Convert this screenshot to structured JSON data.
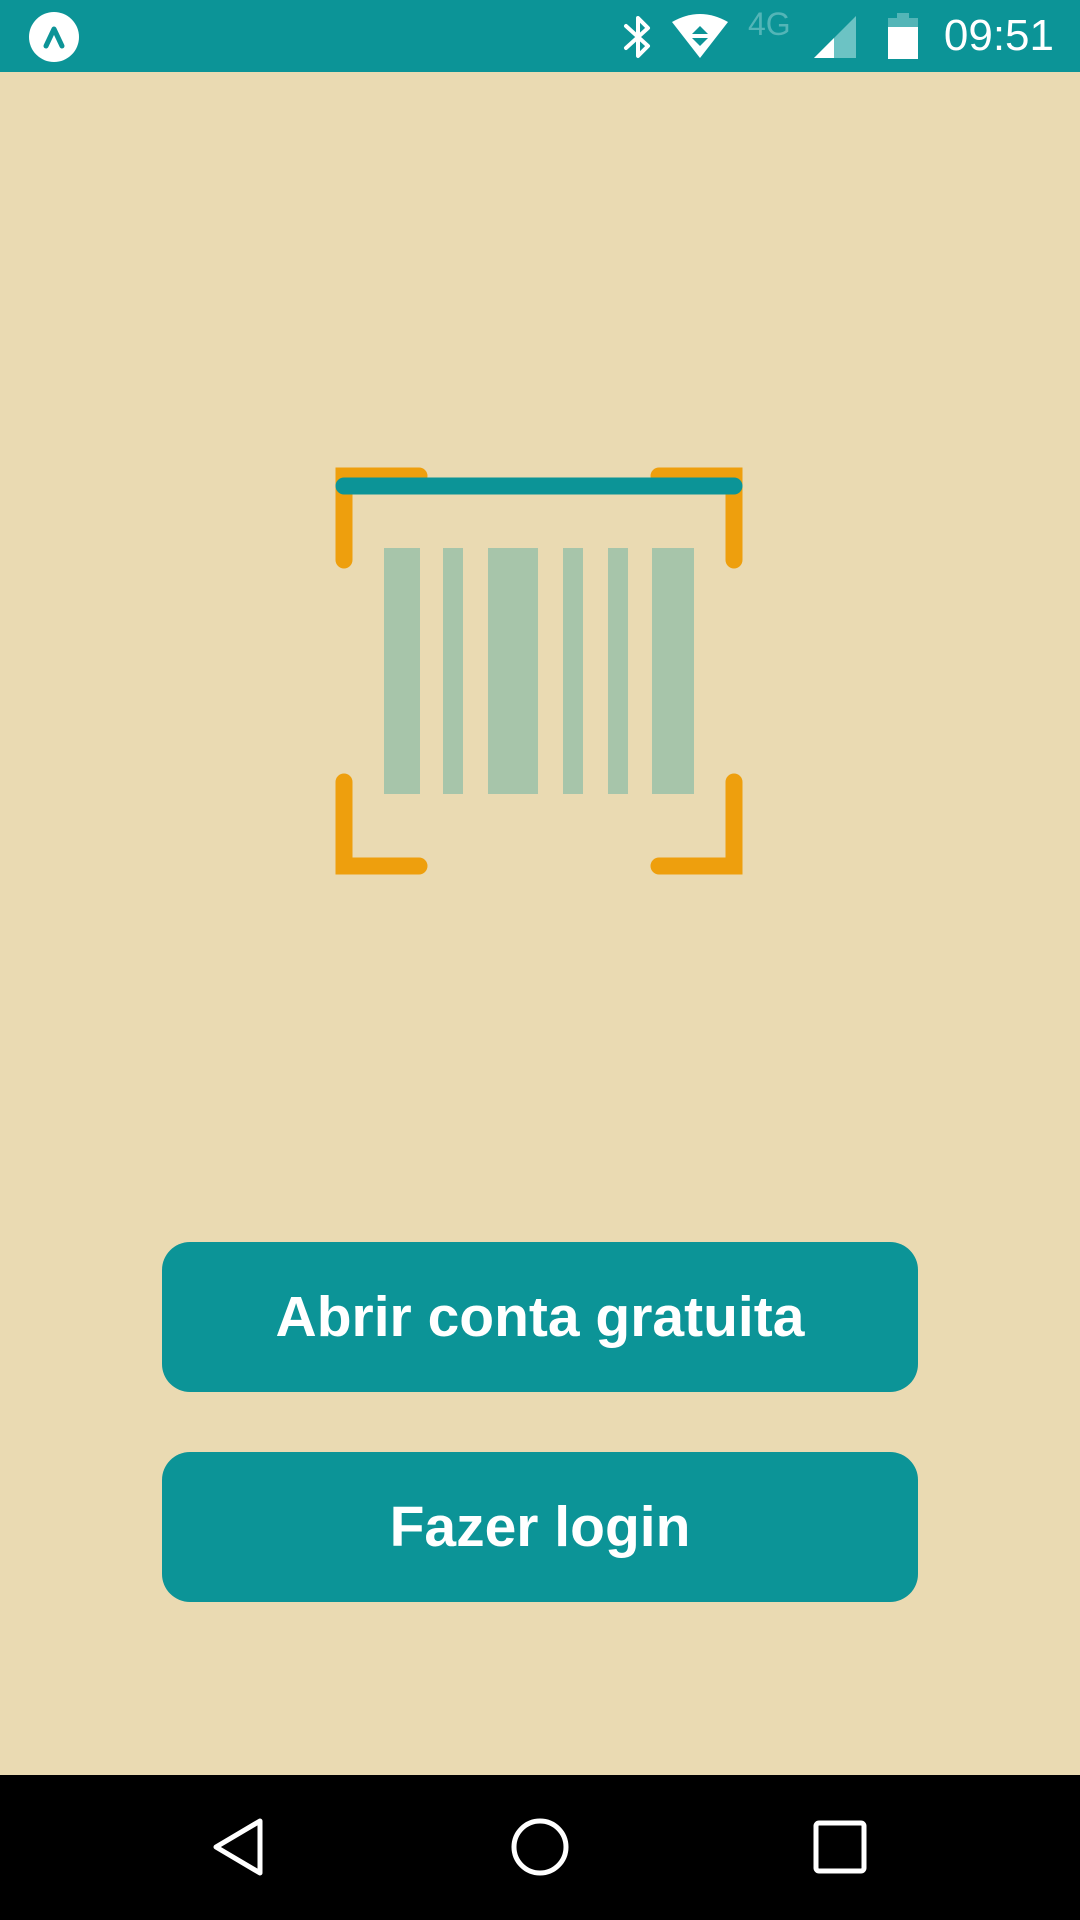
{
  "status_bar": {
    "time": "09:51",
    "network_label": "4G",
    "icons": [
      "app-badge-icon",
      "bluetooth-icon",
      "wifi-icon",
      "cell-signal-icon",
      "battery-icon"
    ]
  },
  "illustration": {
    "icon": "barcode-scanner-icon"
  },
  "actions": {
    "signup_label": "Abrir conta gratuita",
    "login_label": "Fazer login"
  },
  "nav_bar": {
    "icons": [
      "back-icon",
      "home-icon",
      "recents-icon"
    ]
  },
  "colors": {
    "background": "#eadab2",
    "primary": "#0c9497",
    "accent": "#ee9f0d",
    "barcode": "#a7c5aa",
    "nav_bar": "#000000"
  }
}
